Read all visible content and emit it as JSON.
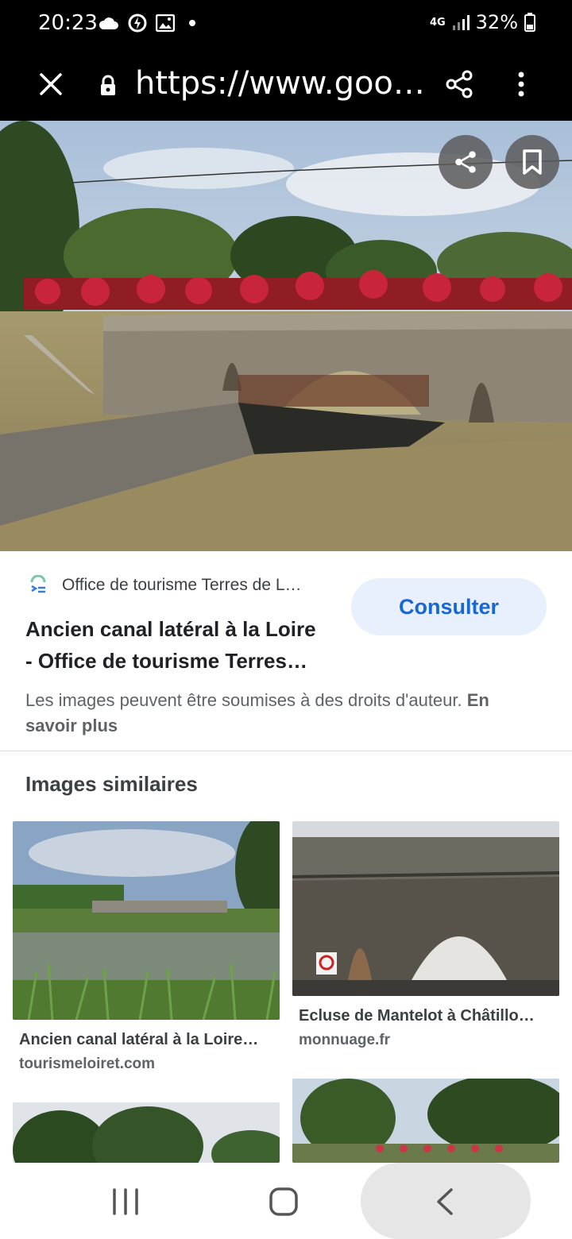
{
  "status_bar": {
    "time": "20:23",
    "network": "4G",
    "battery": "32%"
  },
  "browser": {
    "url": "https://www.google.com",
    "icons": [
      "close-icon",
      "lock-icon",
      "share-icon",
      "more-vert-icon"
    ]
  },
  "hero": {
    "icons": [
      "share-icon",
      "bookmark-icon"
    ]
  },
  "result": {
    "source_name": "Office de tourisme Terres de L…",
    "title_line1": "Ancien canal latéral à la Loire",
    "title_line2": "- Office de tourisme Terres…",
    "consult_label": "Consulter",
    "rights_text": "Les images peuvent être soumises à des droits d'auteur.",
    "learn_more": "En savoir plus"
  },
  "similar": {
    "heading": "Images similaires",
    "items": [
      {
        "title": "Ancien canal latéral à la Loire…",
        "source": "tourismeloiret.com"
      },
      {
        "title": "Ecluse de Mantelot à Châtillo…",
        "source": "monnuage.fr"
      }
    ]
  },
  "colors": {
    "accent": "#1967d2",
    "button_bg": "#e8f0fe",
    "bar_bg": "#000000"
  },
  "nav": {
    "icons": [
      "recent-apps-icon",
      "home-icon",
      "back-icon"
    ]
  }
}
